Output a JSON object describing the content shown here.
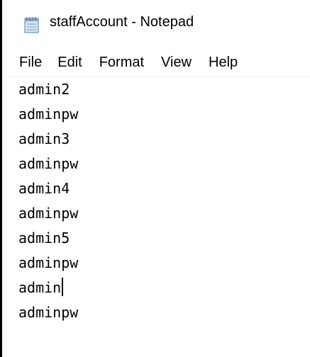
{
  "window": {
    "title": "staffAccount - Notepad",
    "icon": "notepad-icon"
  },
  "menu": {
    "items": [
      "File",
      "Edit",
      "Format",
      "View",
      "Help"
    ]
  },
  "editor": {
    "lines": [
      "admin2",
      "adminpw",
      "admin3",
      "adminpw",
      "admin4",
      "adminpw",
      "admin5",
      "adminpw",
      "admin",
      "adminpw"
    ],
    "caret_line": 9
  }
}
